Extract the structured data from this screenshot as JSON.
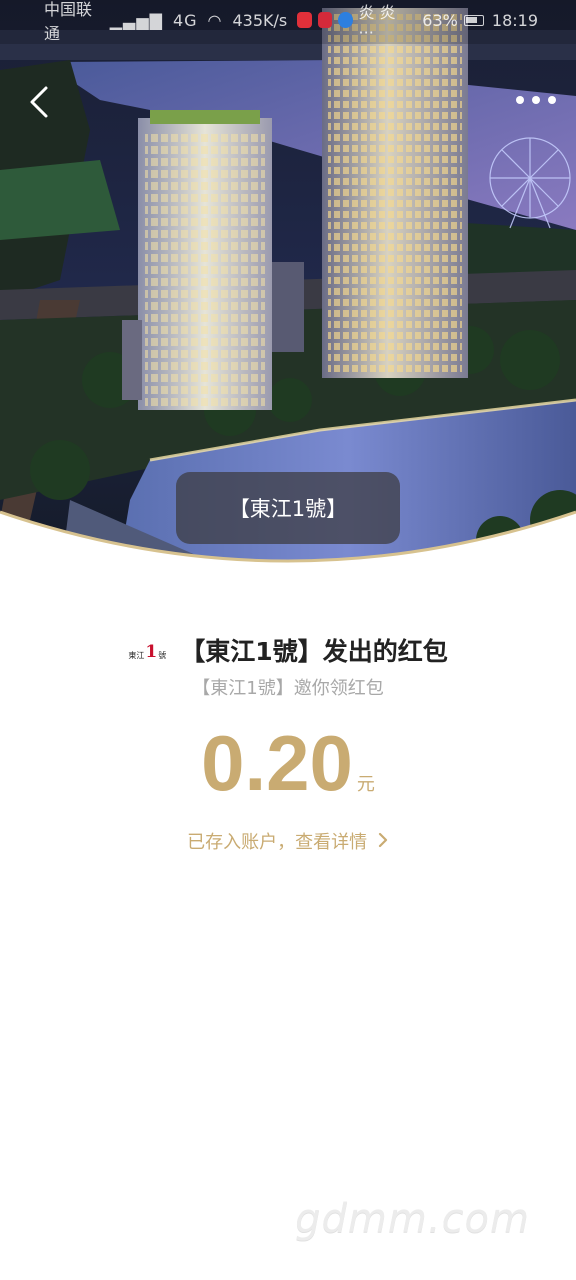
{
  "status_bar": {
    "carrier": "中国联通",
    "network": "4G",
    "speed": "435K/s",
    "misc_text": "炎 炎 ···",
    "battery": "63%",
    "time": "18:19"
  },
  "hero": {
    "caption": "【東江1號】",
    "icons": {
      "back": "chevron-left-icon",
      "more": "more-dots-icon"
    }
  },
  "sender": {
    "logo_small_left": "東江",
    "logo_big": "1",
    "logo_small_right": "號",
    "title": "【東江1號】发出的红包",
    "subtitle": "【東江1號】邀你领红包"
  },
  "amount": {
    "value": "0.20",
    "unit": "元"
  },
  "detail_link": {
    "label": "已存入账户，查看详情",
    "icon": "chevron-right-icon"
  },
  "watermark": "gdmm.com",
  "colors": {
    "gold": "#c9ab72",
    "title": "#222222",
    "subtitle": "#a8a8a8"
  }
}
